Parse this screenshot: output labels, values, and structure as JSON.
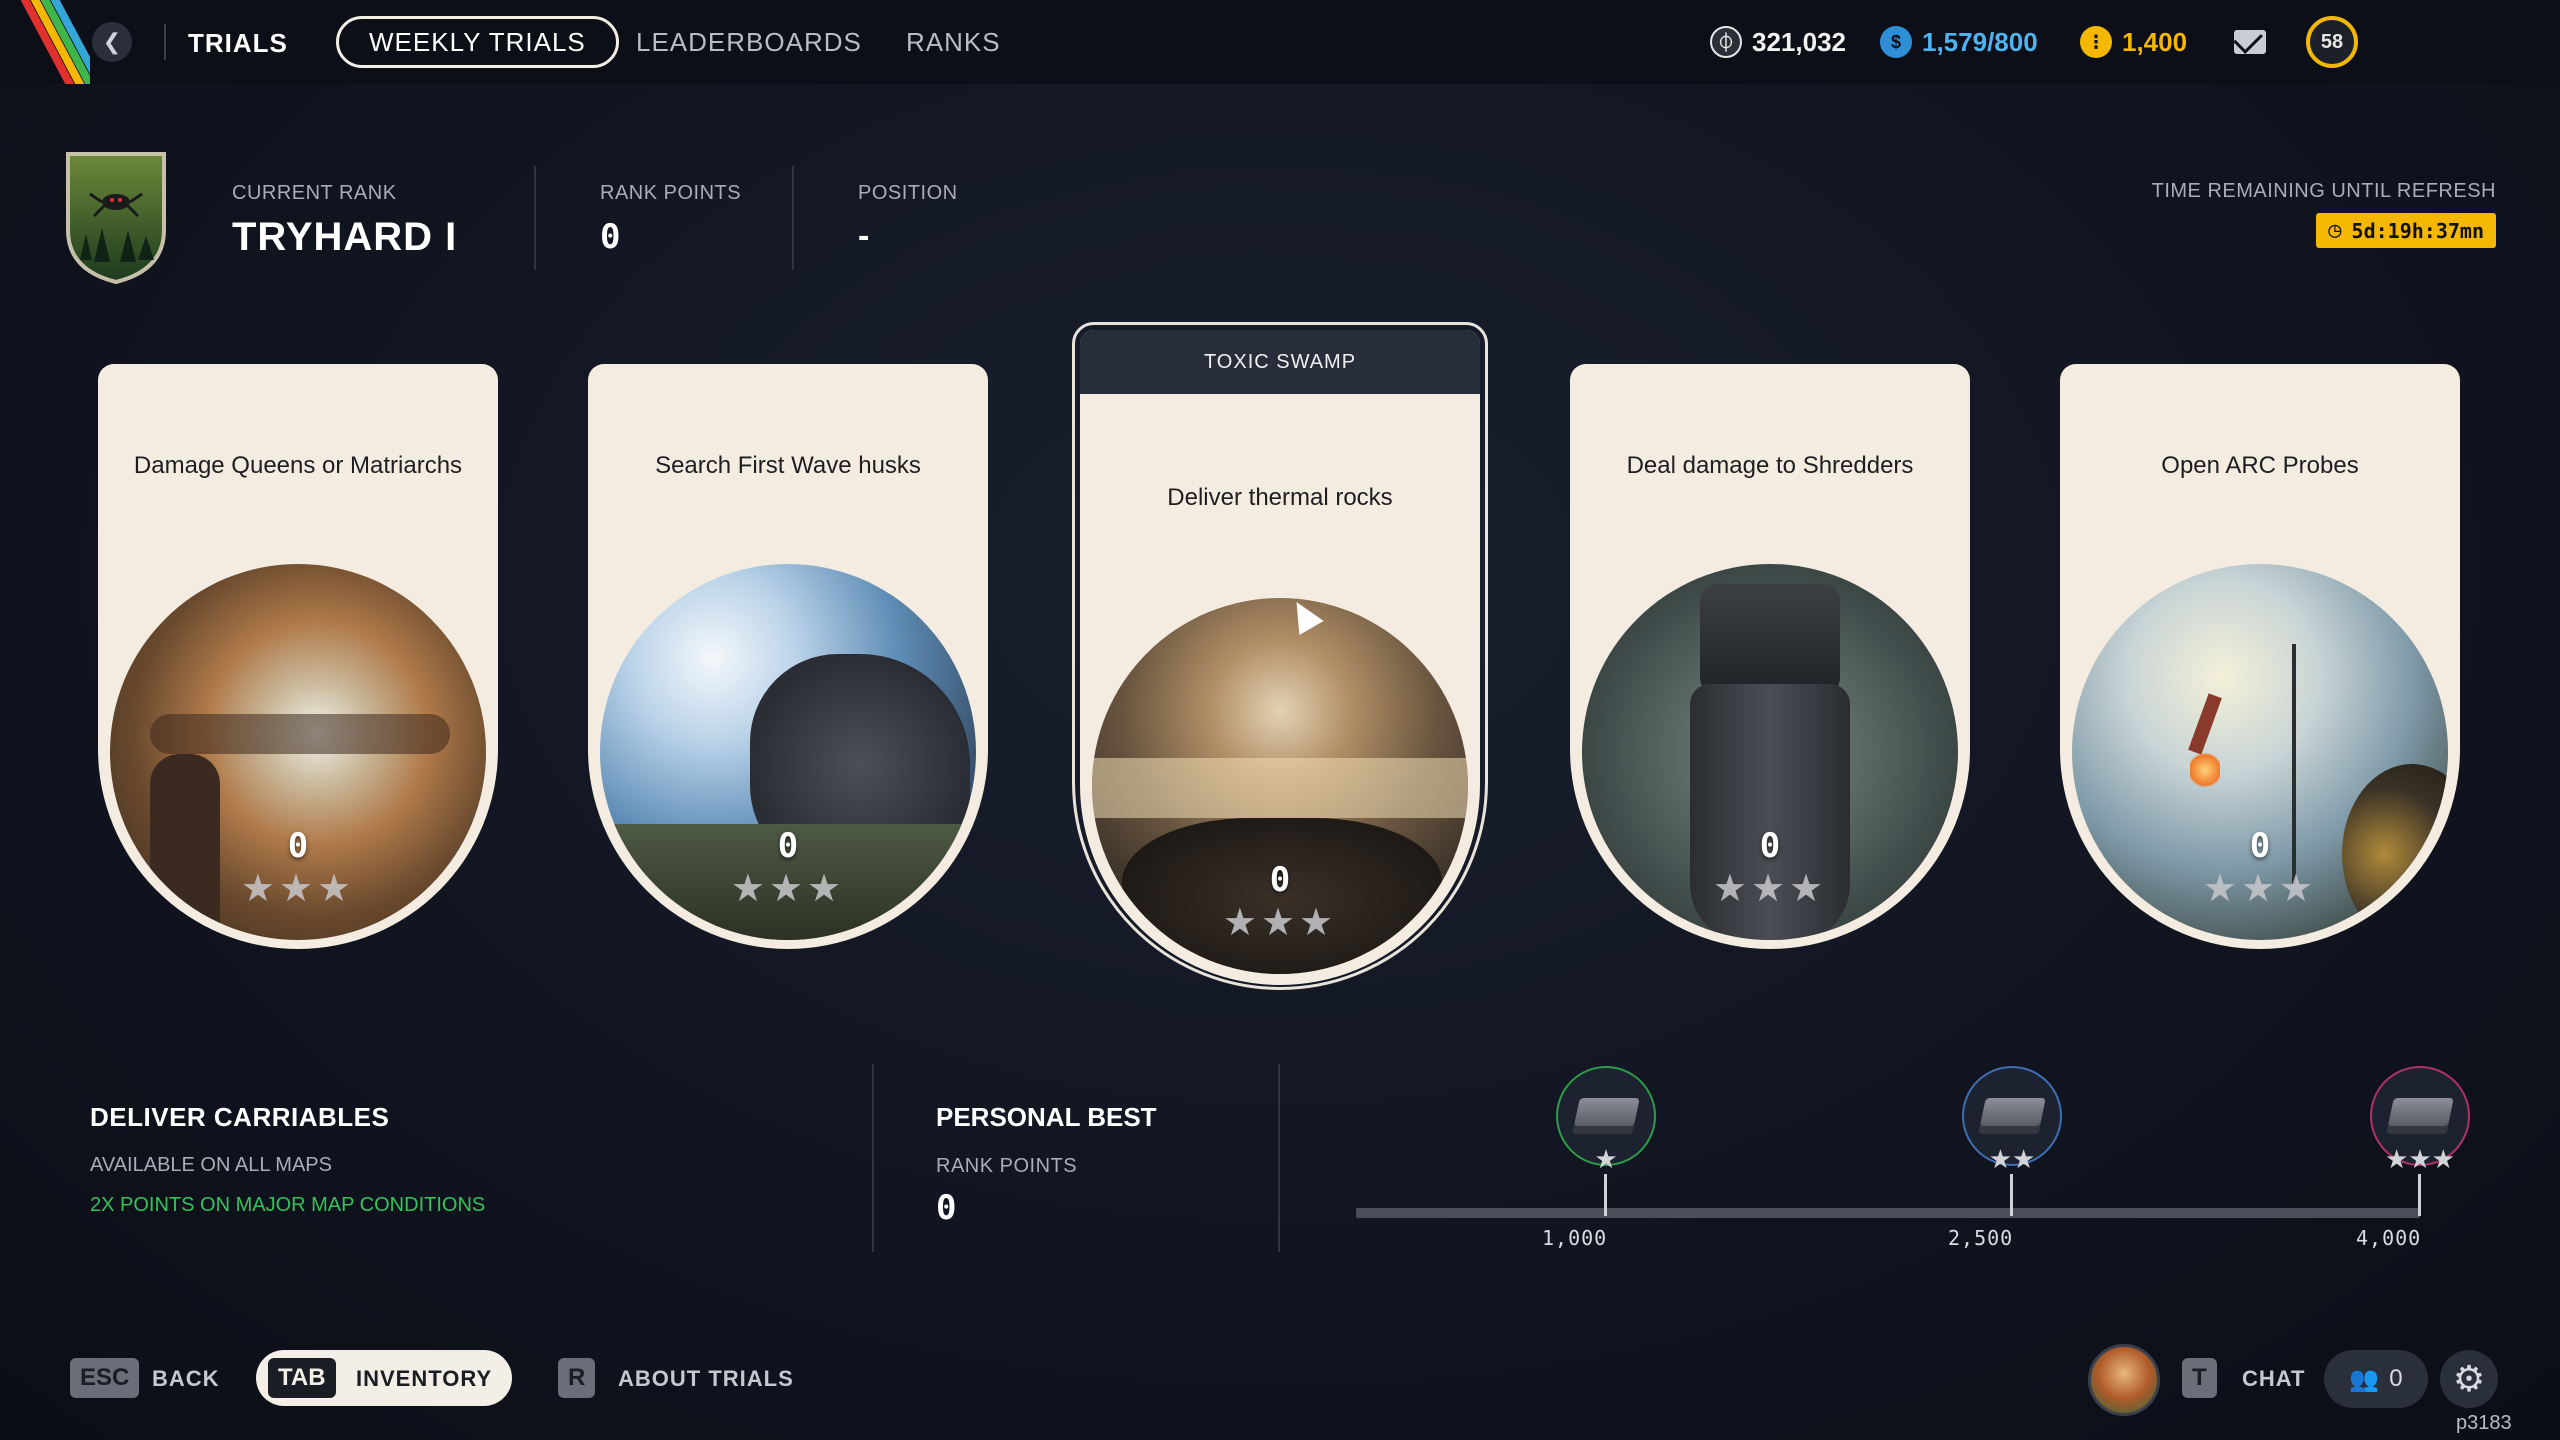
{
  "nav": {
    "title": "TRIALS",
    "tabs": [
      {
        "label": "WEEKLY TRIALS",
        "active": true
      },
      {
        "label": "LEADERBOARDS",
        "active": false
      },
      {
        "label": "RANKS",
        "active": false
      }
    ]
  },
  "currencies": {
    "credits": "321,032",
    "weekly": "1,579/800",
    "coins": "1,400"
  },
  "player": {
    "level": "58"
  },
  "rank": {
    "current_label": "CURRENT RANK",
    "current_value": "TRYHARD I",
    "points_label": "RANK POINTS",
    "points_value": "0",
    "position_label": "POSITION",
    "position_value": "-"
  },
  "refresh": {
    "label": "TIME REMAINING UNTIL REFRESH",
    "value": "5d:19h:37mn"
  },
  "trials": [
    {
      "title": "Damage Queens or Matriarchs",
      "score": "0",
      "stars": "★★★"
    },
    {
      "title": "Search First Wave husks",
      "score": "0",
      "stars": "★★★"
    },
    {
      "title": "Deliver thermal rocks",
      "score": "0",
      "stars": "★★★",
      "header": "TOXIC SWAMP"
    },
    {
      "title": "Deal damage to Shredders",
      "score": "0",
      "stars": "★★★"
    },
    {
      "title": "Open ARC Probes",
      "score": "0",
      "stars": "★★★"
    }
  ],
  "objective": {
    "title": "DELIVER CARRIABLES",
    "availability": "AVAILABLE ON ALL MAPS",
    "bonus": "2X POINTS ON MAJOR MAP CONDITIONS"
  },
  "personal_best": {
    "title": "PERSONAL BEST",
    "label": "RANK POINTS",
    "value": "0"
  },
  "milestones": [
    {
      "value": "1,000",
      "stars": "★",
      "color": "#2e9a4a"
    },
    {
      "value": "2,500",
      "stars": "★★",
      "color": "#3d6fb0"
    },
    {
      "value": "4,000",
      "stars": "★★★",
      "color": "#b0306a"
    }
  ],
  "footer": {
    "back_key": "ESC",
    "back_label": "BACK",
    "inventory_key": "TAB",
    "inventory_label": "INVENTORY",
    "about_key": "R",
    "about_label": "ABOUT TRIALS",
    "chat_key": "T",
    "chat_label": "CHAT",
    "friends_count": "0",
    "corner_id": "p3183"
  },
  "colors": {
    "accent_gold": "#f5b700",
    "bonus_green": "#36c25a",
    "card_bg": "#f4ece0"
  }
}
